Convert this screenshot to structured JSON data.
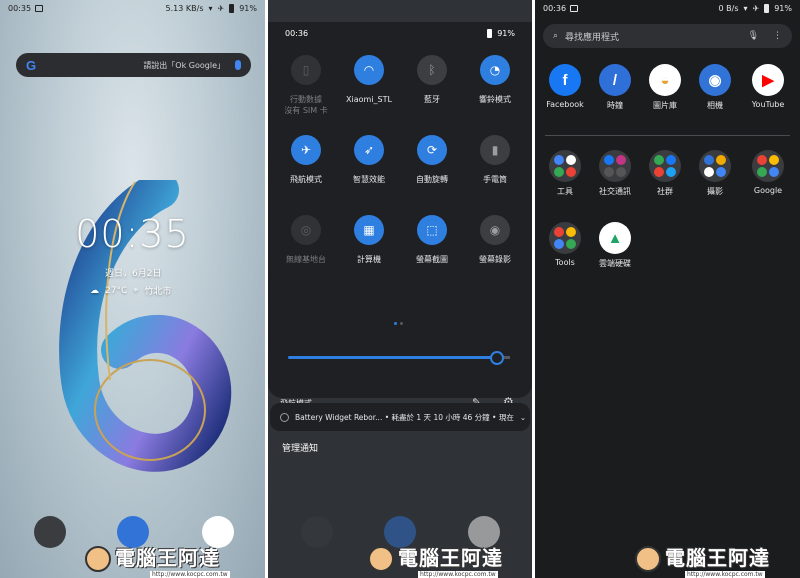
{
  "home": {
    "status": {
      "time": "00:35",
      "speed": "5.13 KB/s",
      "battery": "91%"
    },
    "search_hint": "請說出「Ok Google」",
    "g_logo": "G",
    "clock": "00:35",
    "date": "週日，6月2日",
    "temp": "27°C",
    "location": "竹北市"
  },
  "qs": {
    "status": {
      "time": "00:36",
      "battery": "91%"
    },
    "tiles": [
      {
        "label": "行動數據\n沒有 SIM 卡",
        "icon": "no-sim-icon",
        "state": "dim"
      },
      {
        "label": "Xiaomi_STL",
        "icon": "wifi-icon",
        "state": "on"
      },
      {
        "label": "藍牙",
        "icon": "bluetooth-icon",
        "state": "off"
      },
      {
        "label": "響鈴模式",
        "icon": "bell-icon",
        "state": "on"
      },
      {
        "label": "飛航模式",
        "icon": "airplane-icon",
        "state": "on"
      },
      {
        "label": "智慧效能",
        "icon": "rocket-icon",
        "state": "on"
      },
      {
        "label": "自動旋轉",
        "icon": "rotate-icon",
        "state": "on"
      },
      {
        "label": "手電筒",
        "icon": "flashlight-icon",
        "state": "off"
      },
      {
        "label": "無線基地台",
        "icon": "hotspot-icon",
        "state": "dim"
      },
      {
        "label": "計算機",
        "icon": "calculator-icon",
        "state": "on"
      },
      {
        "label": "螢幕截圖",
        "icon": "screenshot-icon",
        "state": "on"
      },
      {
        "label": "螢幕錄影",
        "icon": "record-icon",
        "state": "off"
      }
    ],
    "footer_label": "飛航模式",
    "brightness_level": 0.94,
    "notification": "Battery Widget Rebor... • 耗盡於 1 天 10 小時 46 分鐘 • 現在",
    "manage": "管理通知"
  },
  "drawer": {
    "status": {
      "time": "00:36",
      "speed": "0 B/s",
      "battery": "91%"
    },
    "search_placeholder": "尋找應用程式",
    "apps": [
      {
        "label": "Facebook",
        "icon": "facebook-icon",
        "color": "#1877f2",
        "glyph": "f"
      },
      {
        "label": "時鐘",
        "icon": "clock-icon",
        "color": "#2f6fd8",
        "glyph": "/"
      },
      {
        "label": "圖片庫",
        "icon": "gallery-icon",
        "color": "#ffffff",
        "glyph": "◒"
      },
      {
        "label": "相機",
        "icon": "camera-icon",
        "color": "#3273d8",
        "glyph": "◉"
      },
      {
        "label": "YouTube",
        "icon": "youtube-icon",
        "color": "#ffffff",
        "glyph": "▶"
      }
    ],
    "folders": [
      {
        "label": "工具",
        "icon": "tools-folder-icon"
      },
      {
        "label": "社交通訊",
        "icon": "social-folder-icon"
      },
      {
        "label": "社群",
        "icon": "community-folder-icon"
      },
      {
        "label": "攝影",
        "icon": "photo-folder-icon"
      },
      {
        "label": "Google",
        "icon": "google-folder-icon"
      }
    ],
    "row3": [
      {
        "label": "Tools",
        "icon": "tools-icon"
      },
      {
        "label": "雲端硬碟",
        "icon": "drive-icon"
      }
    ]
  },
  "watermark": {
    "text": "電腦王阿達",
    "url": "http://www.kocpc.com.tw"
  }
}
